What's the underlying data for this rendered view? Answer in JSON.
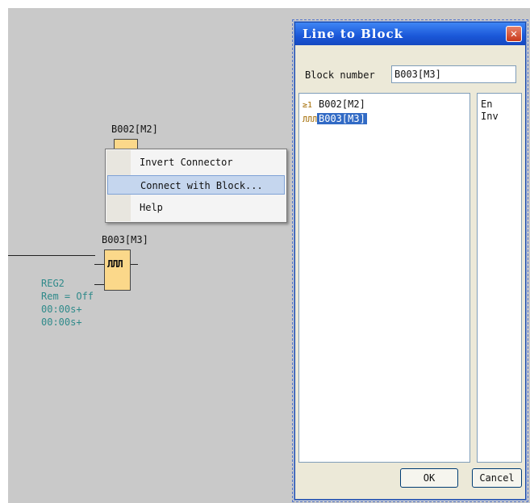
{
  "diagram": {
    "block_b002_label": "B002[M2]",
    "block_b003_label": "B003[M3]",
    "block_b003_symbol": "ЛЛЛ",
    "b003_params": [
      "REG2",
      "Rem = Off",
      "00:00s+",
      "00:00s+"
    ]
  },
  "context_menu": {
    "items": [
      {
        "label": "Invert Connector",
        "highlighted": false
      },
      {
        "label": "Connect with Block...",
        "highlighted": true
      },
      {
        "label": "Help",
        "highlighted": false
      }
    ]
  },
  "dialog": {
    "title": "Line to Block",
    "block_number_label": "Block number",
    "block_number_value": "B003[M3]",
    "blocks": [
      {
        "icon": "≥1",
        "label": "B002[M2]",
        "selected": false
      },
      {
        "icon": "ЛЛЛ",
        "label": "B003[M3]",
        "selected": true
      }
    ],
    "connectors": [
      "En",
      "Inv"
    ],
    "ok_label": "OK",
    "cancel_label": "Cancel"
  },
  "colors": {
    "canvas": "#c9c9c9",
    "block_fill": "#fbd88a",
    "param_text": "#2f8a8a",
    "titlebar": "#1a57d8",
    "selection": "#316ac5"
  }
}
